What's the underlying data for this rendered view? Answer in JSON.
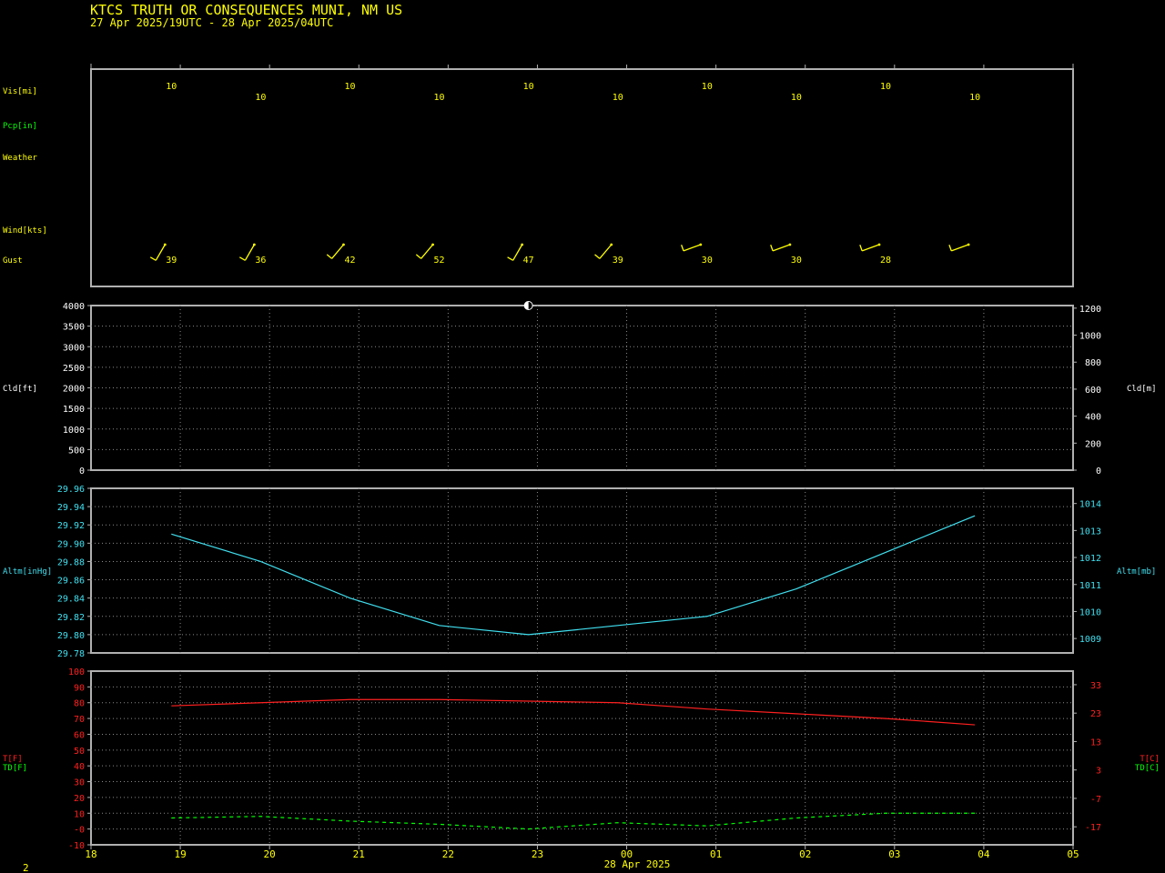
{
  "header": {
    "title": "KTCS  TRUTH OR CONSEQUENCES MUNI, NM US",
    "subtitle": "27 Apr 2025/19UTC - 28 Apr 2025/04UTC"
  },
  "footer": {
    "page_number": "2",
    "date_label": "28 Apr 2025"
  },
  "colors": {
    "background": "#000000",
    "frame": "#b0b0b0",
    "label_yellow": "#ffff00",
    "pcp_green": "#00ff00",
    "altimeter_cyan": "#40e0f0",
    "temp_red": "#ff2020",
    "dewpoint_green": "#00ff00"
  },
  "x_axis": {
    "ticks": [
      "18",
      "19",
      "20",
      "21",
      "22",
      "23",
      "00",
      "01",
      "02",
      "03",
      "04",
      "05"
    ]
  },
  "chart_data": [
    {
      "type": "table",
      "panel": "surface-observations",
      "row_labels": {
        "visibility": "Vis[mi]",
        "precip": "Pcp[in]",
        "weather": "Weather",
        "wind": "Wind[kts]",
        "gust": "Gust"
      },
      "obs_hours": [
        18.9,
        19.9,
        20.9,
        21.9,
        22.9,
        23.9,
        24.9,
        25.9,
        26.9,
        27.9
      ],
      "visibility": [
        "10",
        "10",
        "10",
        "10",
        "10",
        "10",
        "10",
        "10",
        "10",
        "10"
      ],
      "gust": [
        "39",
        "36",
        "42",
        "52",
        "47",
        "39",
        "30",
        "30",
        "28",
        ""
      ],
      "wind_barb_direction_deg": [
        210,
        210,
        220,
        220,
        210,
        220,
        250,
        250,
        250,
        250
      ],
      "wind_barb_color": "#ffff00"
    },
    {
      "type": "scatter",
      "panel": "cloud",
      "ylabel_left": "Cld[ft]",
      "ylabel_right": "Cld[m]",
      "ylim": [
        0,
        4000
      ],
      "yticks_left": [
        "0",
        "500",
        "1000",
        "1500",
        "2000",
        "2500",
        "3000",
        "3500",
        "4000"
      ],
      "yticks_right": [
        "0",
        "200",
        "400",
        "600",
        "800",
        "1000",
        "1200"
      ],
      "series": [
        {
          "x": [
            22.9
          ],
          "y": [
            4000
          ],
          "symbol": "half-filled-circle"
        }
      ],
      "grid": true
    },
    {
      "type": "line",
      "panel": "altimeter",
      "ylabel_left": "Altm[inHg]",
      "ylabel_right": "Altm[mb]",
      "ylim": [
        29.78,
        29.96
      ],
      "yticks_left": [
        "29.78",
        "29.80",
        "29.82",
        "29.84",
        "29.86",
        "29.88",
        "29.90",
        "29.92",
        "29.94",
        "29.96"
      ],
      "yticks_right": [
        "1009",
        "1010",
        "1011",
        "1012",
        "1013",
        "1014"
      ],
      "series": [
        {
          "x": [
            18.9,
            19.9,
            20.9,
            21.9,
            22.9,
            23.9,
            24.9,
            25.9,
            26.9,
            27.9
          ],
          "y": [
            29.91,
            29.88,
            29.84,
            29.81,
            29.8,
            29.81,
            29.82,
            29.85,
            29.89,
            29.93
          ],
          "color": "#40e0f0"
        }
      ],
      "grid": true
    },
    {
      "type": "line",
      "panel": "temperature",
      "ylabel_left": [
        "T[F]",
        "TD[F]"
      ],
      "ylabel_right": [
        "T[C]",
        "TD[C]"
      ],
      "ylim": [
        -10,
        100
      ],
      "yticks_left": [
        "-10",
        "-0",
        "10",
        "20",
        "30",
        "40",
        "50",
        "60",
        "70",
        "80",
        "90",
        "100"
      ],
      "yticks_right": [
        "-17",
        "-7",
        "3",
        "13",
        "23",
        "33"
      ],
      "series": [
        {
          "x": [
            18.9,
            19.9,
            20.9,
            21.9,
            22.9,
            23.9,
            24.9,
            25.9,
            26.9,
            27.9
          ],
          "y": [
            78,
            80,
            82,
            82,
            81,
            80,
            76,
            73,
            70,
            66
          ],
          "color": "#ff2020",
          "style": "solid"
        },
        {
          "x": [
            18.9,
            19.9,
            20.9,
            21.9,
            22.9,
            23.9,
            24.9,
            25.9,
            26.9,
            27.9
          ],
          "y": [
            7,
            8,
            5,
            3,
            0,
            4,
            2,
            7,
            10,
            10
          ],
          "color": "#00ff00",
          "style": "dashed"
        }
      ],
      "grid": true
    }
  ]
}
